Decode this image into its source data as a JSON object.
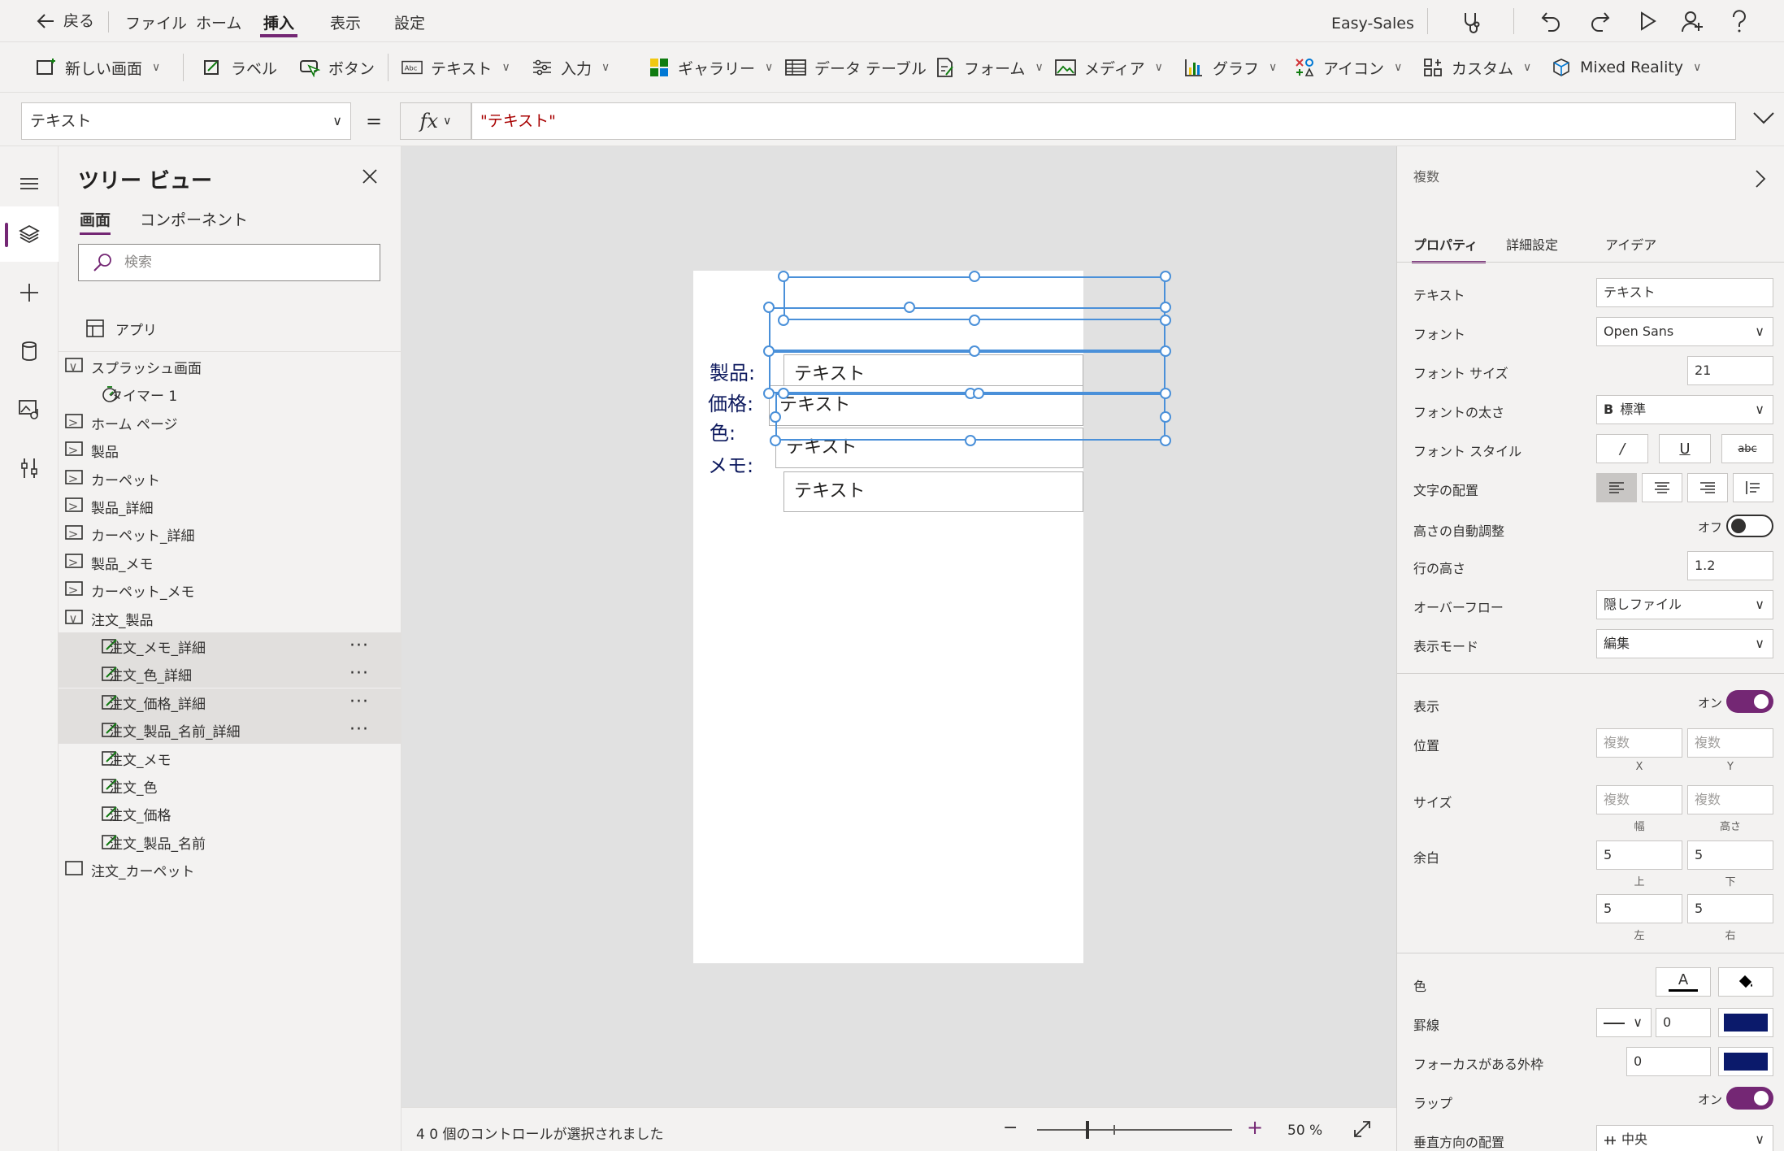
{
  "menu": {
    "back": "戻る",
    "items": [
      "ファイル",
      "ホーム",
      "挿入",
      "表示",
      "設定"
    ],
    "app_name": "Easy-Sales"
  },
  "ribbon": {
    "new_screen": "新しい画面",
    "label": "ラベル",
    "button": "ボタン",
    "text": "テキスト",
    "input": "入力",
    "gallery": "ギャラリー",
    "data_table": "データ テーブル",
    "form": "フォーム",
    "media": "メディア",
    "chart": "グラフ",
    "icon": "アイコン",
    "custom": "カスタム",
    "mixed_reality": "Mixed Reality"
  },
  "formula": {
    "property": "テキスト",
    "equals": "=",
    "fx": "fx",
    "value": "\"テキスト\""
  },
  "tree": {
    "title": "ツリー ビュー",
    "tabs": [
      "画面",
      "コンポーネント"
    ],
    "search_placeholder": "検索",
    "app": "アプリ",
    "rows": [
      {
        "label": "スプラッシュ画面"
      },
      {
        "label": "タイマー 1"
      },
      {
        "label": "ホーム ページ"
      },
      {
        "label": "製品"
      },
      {
        "label": "カーペット"
      },
      {
        "label": "製品_詳細"
      },
      {
        "label": "カーペット_詳細"
      },
      {
        "label": "製品_メモ"
      },
      {
        "label": "カーペット_メモ"
      },
      {
        "label": "注文_製品"
      },
      {
        "label": "注文_メモ_詳細"
      },
      {
        "label": "注文_色_詳細"
      },
      {
        "label": "注文_価格_詳細"
      },
      {
        "label": "注文_製品_名前_詳細"
      },
      {
        "label": "注文_メモ"
      },
      {
        "label": "注文_色"
      },
      {
        "label": "注文_価格"
      },
      {
        "label": "注文_製品_名前"
      },
      {
        "label": "注文_カーペット"
      }
    ]
  },
  "canvas": {
    "labels": [
      "製品:",
      "価格:",
      "色:",
      "メモ:"
    ],
    "textboxes": [
      "テキスト",
      "テキスト",
      "テキスト",
      "テキスト"
    ]
  },
  "status": {
    "selection": "4 0 個のコントロールが選択されました",
    "zoom": "50 %"
  },
  "props": {
    "header": "複数",
    "tabs": [
      "プロパティ",
      "詳細設定",
      "アイデア"
    ],
    "text_label": "テキスト",
    "text_value": "テキスト",
    "font_label": "フォント",
    "font_value": "Open Sans",
    "font_size_label": "フォント サイズ",
    "font_size_value": "21",
    "font_weight_label": "フォントの太さ",
    "font_weight_value": "標準",
    "font_weight_prefix": "B",
    "font_style_label": "フォント スタイル",
    "font_style_italic": "/",
    "font_style_underline": "U",
    "font_style_strike": "abc",
    "align_label": "文字の配置",
    "auto_height_label": "高さの自動調整",
    "auto_height_value": "オフ",
    "line_height_label": "行の高さ",
    "line_height_value": "1.2",
    "overflow_label": "オーバーフロー",
    "overflow_value": "隠しファイル",
    "display_mode_label": "表示モード",
    "display_mode_value": "編集",
    "visible_label": "表示",
    "visible_value": "オン",
    "position_label": "位置",
    "multi": "複数",
    "x": "X",
    "y": "Y",
    "size_label": "サイズ",
    "width": "幅",
    "height": "高さ",
    "padding_label": "余白",
    "pad_top": "5",
    "pad_bottom": "5",
    "pad_left": "5",
    "pad_right": "5",
    "top": "上",
    "bottom": "下",
    "left": "左",
    "right": "右",
    "color_label": "色",
    "color_text_glyph": "A",
    "border_label": "罫線",
    "border_value": "0",
    "focus_border_label": "フォーカスがある外枠",
    "focus_border_value": "0",
    "wrap_label": "ラップ",
    "wrap_value": "オン",
    "valign_label": "垂直方向の配置",
    "valign_value": "中央"
  },
  "colors": {
    "accent": "#742774",
    "border_swatch": "#0b1a6b",
    "label_text": "#0e1a5e",
    "selection": "#4a90d9"
  }
}
